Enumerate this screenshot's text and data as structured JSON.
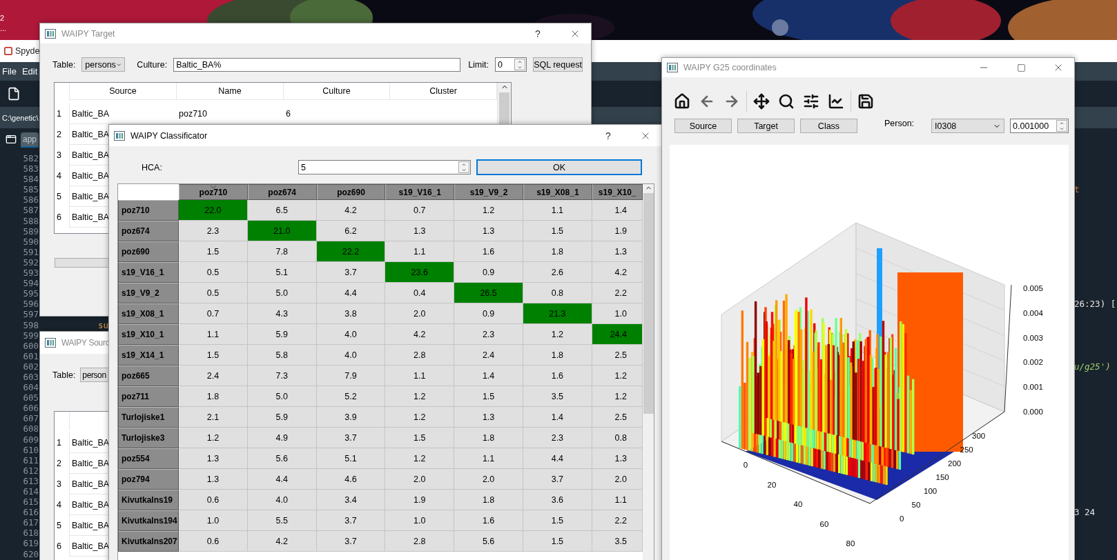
{
  "desktop": {
    "labels": [
      "2",
      "..."
    ]
  },
  "spyder": {
    "title": "Spyde",
    "menu": [
      "File",
      "Edit"
    ],
    "path": "C:\\genetic\\",
    "tab": "app",
    "lines": [
      {
        "number": "582"
      },
      {
        "number": "583"
      },
      {
        "number": "584"
      },
      {
        "number": "585",
        "console": {
          "text": "t",
          "kind": "keyword"
        }
      },
      {
        "number": "586"
      },
      {
        "number": "587"
      },
      {
        "number": "588"
      },
      {
        "number": "589"
      },
      {
        "number": "590"
      },
      {
        "number": "591"
      },
      {
        "number": "592"
      },
      {
        "number": "593"
      },
      {
        "number": "594"
      },
      {
        "number": "595"
      },
      {
        "number": "596",
        "console": {
          "text": "26:23) [",
          "kind": "plain"
        }
      },
      {
        "number": "597"
      },
      {
        "number": "598",
        "code": "su"
      },
      {
        "number": "599"
      },
      {
        "number": "600"
      },
      {
        "number": "601"
      },
      {
        "number": "602",
        "console": {
          "text": "u/g25')",
          "kind": "string"
        }
      },
      {
        "number": "603"
      },
      {
        "number": "604"
      },
      {
        "number": "605"
      },
      {
        "number": "606"
      },
      {
        "number": "607"
      },
      {
        "number": "608"
      },
      {
        "number": "609"
      },
      {
        "number": "610"
      },
      {
        "number": "611"
      },
      {
        "number": "612"
      },
      {
        "number": "613"
      },
      {
        "number": "614"
      },
      {
        "number": "615"
      },
      {
        "number": "616",
        "console": {
          "text": "3 24",
          "kind": "plain"
        }
      },
      {
        "number": "617"
      },
      {
        "number": "618"
      },
      {
        "number": "619"
      },
      {
        "number": "620"
      }
    ]
  },
  "target_window": {
    "title": "WAIPY Target",
    "help": "?",
    "table_label": "Table:",
    "table_value": "persons",
    "culture_label": "Culture:",
    "culture_value": "Baltic_BA%",
    "limit_label": "Limit:",
    "limit_value": "0",
    "sql_button": "SQL request",
    "columns": [
      "Source",
      "Name",
      "Culture",
      "Cluster"
    ],
    "rows": [
      {
        "number": "1",
        "cells": [
          "Baltic_BA",
          "poz710",
          "6"
        ]
      },
      {
        "number": "2",
        "cells": [
          "Baltic_BA"
        ]
      },
      {
        "number": "3",
        "cells": [
          "Baltic_BA"
        ]
      },
      {
        "number": "4",
        "cells": [
          "Baltic_BA"
        ]
      },
      {
        "number": "5",
        "cells": [
          "Baltic_BA"
        ]
      },
      {
        "number": "6",
        "cells": [
          "Baltic_BA"
        ]
      }
    ]
  },
  "source_window": {
    "title": "WAIPY Sourc",
    "table_label": "Table:",
    "table_value": "person",
    "rows": [
      {
        "number": "1",
        "cells": [
          "Baltic_BA"
        ]
      },
      {
        "number": "2",
        "cells": [
          "Baltic_BA"
        ]
      },
      {
        "number": "3",
        "cells": [
          "Baltic_BA"
        ]
      },
      {
        "number": "4",
        "cells": [
          "Baltic_BA"
        ]
      },
      {
        "number": "5",
        "cells": [
          "Baltic_BA"
        ]
      },
      {
        "number": "6",
        "cells": [
          "Baltic_BA"
        ]
      }
    ]
  },
  "classificator_window": {
    "title": "WAIPY Classificator",
    "help": "?",
    "hca_label": "HCA:",
    "hca_value": "5",
    "ok_button": "OK",
    "columns": [
      {
        "label": "poz710",
        "sorted": true
      },
      {
        "label": "poz674",
        "sorted": false
      },
      {
        "label": "poz690",
        "sorted": false
      },
      {
        "label": "s19_V16_1",
        "sorted": false
      },
      {
        "label": "s19_V9_2",
        "sorted": false
      },
      {
        "label": "s19_X08_1",
        "sorted": false
      },
      {
        "label": "s19_X10_",
        "sorted": false
      }
    ],
    "rows": [
      {
        "name": "poz710",
        "cells": [
          {
            "text": "22.0",
            "highlighted": true
          },
          {
            "text": "6.5",
            "highlighted": false
          },
          {
            "text": "4.2",
            "highlighted": false
          },
          {
            "text": "0.7",
            "highlighted": false
          },
          {
            "text": "1.2",
            "highlighted": false
          },
          {
            "text": "1.1",
            "highlighted": false
          },
          {
            "text": "1.4",
            "highlighted": false
          }
        ]
      },
      {
        "name": "poz674",
        "cells": [
          {
            "text": "2.3",
            "highlighted": false
          },
          {
            "text": "21.0",
            "highlighted": true
          },
          {
            "text": "6.2",
            "highlighted": false
          },
          {
            "text": "1.3",
            "highlighted": false
          },
          {
            "text": "1.3",
            "highlighted": false
          },
          {
            "text": "1.5",
            "highlighted": false
          },
          {
            "text": "1.9",
            "highlighted": false
          }
        ]
      },
      {
        "name": "poz690",
        "cells": [
          {
            "text": "1.5",
            "highlighted": false
          },
          {
            "text": "7.8",
            "highlighted": false
          },
          {
            "text": "22.2",
            "highlighted": true
          },
          {
            "text": "1.1",
            "highlighted": false
          },
          {
            "text": "1.6",
            "highlighted": false
          },
          {
            "text": "1.8",
            "highlighted": false
          },
          {
            "text": "1.3",
            "highlighted": false
          }
        ]
      },
      {
        "name": "s19_V16_1",
        "cells": [
          {
            "text": "0.5",
            "highlighted": false
          },
          {
            "text": "5.1",
            "highlighted": false
          },
          {
            "text": "3.7",
            "highlighted": false
          },
          {
            "text": "23.6",
            "highlighted": true
          },
          {
            "text": "0.9",
            "highlighted": false
          },
          {
            "text": "2.6",
            "highlighted": false
          },
          {
            "text": "4.2",
            "highlighted": false
          }
        ]
      },
      {
        "name": "s19_V9_2",
        "cells": [
          {
            "text": "0.5",
            "highlighted": false
          },
          {
            "text": "5.0",
            "highlighted": false
          },
          {
            "text": "4.4",
            "highlighted": false
          },
          {
            "text": "0.4",
            "highlighted": false
          },
          {
            "text": "26.5",
            "highlighted": true
          },
          {
            "text": "0.8",
            "highlighted": false
          },
          {
            "text": "2.2",
            "highlighted": false
          }
        ]
      },
      {
        "name": "s19_X08_1",
        "cells": [
          {
            "text": "0.7",
            "highlighted": false
          },
          {
            "text": "4.3",
            "highlighted": false
          },
          {
            "text": "3.8",
            "highlighted": false
          },
          {
            "text": "2.0",
            "highlighted": false
          },
          {
            "text": "0.9",
            "highlighted": false
          },
          {
            "text": "21.3",
            "highlighted": true
          },
          {
            "text": "1.0",
            "highlighted": false
          }
        ]
      },
      {
        "name": "s19_X10_1",
        "cells": [
          {
            "text": "1.1",
            "highlighted": false
          },
          {
            "text": "5.9",
            "highlighted": false
          },
          {
            "text": "4.0",
            "highlighted": false
          },
          {
            "text": "4.2",
            "highlighted": false
          },
          {
            "text": "2.3",
            "highlighted": false
          },
          {
            "text": "1.2",
            "highlighted": false
          },
          {
            "text": "24.4",
            "highlighted": true
          }
        ]
      },
      {
        "name": "s19_X14_1",
        "cells": [
          {
            "text": "1.5",
            "highlighted": false
          },
          {
            "text": "5.8",
            "highlighted": false
          },
          {
            "text": "4.0",
            "highlighted": false
          },
          {
            "text": "2.8",
            "highlighted": false
          },
          {
            "text": "2.4",
            "highlighted": false
          },
          {
            "text": "1.8",
            "highlighted": false
          },
          {
            "text": "2.5",
            "highlighted": false
          }
        ]
      },
      {
        "name": "poz665",
        "cells": [
          {
            "text": "2.4",
            "highlighted": false
          },
          {
            "text": "7.3",
            "highlighted": false
          },
          {
            "text": "7.9",
            "highlighted": false
          },
          {
            "text": "1.1",
            "highlighted": false
          },
          {
            "text": "1.4",
            "highlighted": false
          },
          {
            "text": "1.6",
            "highlighted": false
          },
          {
            "text": "1.2",
            "highlighted": false
          }
        ]
      },
      {
        "name": "poz711",
        "cells": [
          {
            "text": "1.8",
            "highlighted": false
          },
          {
            "text": "5.0",
            "highlighted": false
          },
          {
            "text": "5.2",
            "highlighted": false
          },
          {
            "text": "1.2",
            "highlighted": false
          },
          {
            "text": "1.5",
            "highlighted": false
          },
          {
            "text": "3.5",
            "highlighted": false
          },
          {
            "text": "1.2",
            "highlighted": false
          }
        ]
      },
      {
        "name": "Turlojiske1",
        "cells": [
          {
            "text": "2.1",
            "highlighted": false
          },
          {
            "text": "5.9",
            "highlighted": false
          },
          {
            "text": "3.9",
            "highlighted": false
          },
          {
            "text": "1.2",
            "highlighted": false
          },
          {
            "text": "1.3",
            "highlighted": false
          },
          {
            "text": "1.4",
            "highlighted": false
          },
          {
            "text": "2.5",
            "highlighted": false
          }
        ]
      },
      {
        "name": "Turlojiske3",
        "cells": [
          {
            "text": "1.2",
            "highlighted": false
          },
          {
            "text": "4.9",
            "highlighted": false
          },
          {
            "text": "3.7",
            "highlighted": false
          },
          {
            "text": "1.5",
            "highlighted": false
          },
          {
            "text": "1.8",
            "highlighted": false
          },
          {
            "text": "2.3",
            "highlighted": false
          },
          {
            "text": "0.8",
            "highlighted": false
          }
        ]
      },
      {
        "name": "poz554",
        "cells": [
          {
            "text": "1.3",
            "highlighted": false
          },
          {
            "text": "5.6",
            "highlighted": false
          },
          {
            "text": "5.1",
            "highlighted": false
          },
          {
            "text": "1.2",
            "highlighted": false
          },
          {
            "text": "1.1",
            "highlighted": false
          },
          {
            "text": "4.4",
            "highlighted": false
          },
          {
            "text": "1.3",
            "highlighted": false
          }
        ]
      },
      {
        "name": "poz794",
        "cells": [
          {
            "text": "1.3",
            "highlighted": false
          },
          {
            "text": "4.4",
            "highlighted": false
          },
          {
            "text": "4.6",
            "highlighted": false
          },
          {
            "text": "2.0",
            "highlighted": false
          },
          {
            "text": "2.0",
            "highlighted": false
          },
          {
            "text": "3.7",
            "highlighted": false
          },
          {
            "text": "2.0",
            "highlighted": false
          }
        ]
      },
      {
        "name": "Kivutkalns19",
        "cells": [
          {
            "text": "0.6",
            "highlighted": false
          },
          {
            "text": "4.0",
            "highlighted": false
          },
          {
            "text": "3.4",
            "highlighted": false
          },
          {
            "text": "1.9",
            "highlighted": false
          },
          {
            "text": "1.8",
            "highlighted": false
          },
          {
            "text": "3.6",
            "highlighted": false
          },
          {
            "text": "1.1",
            "highlighted": false
          }
        ]
      },
      {
        "name": "Kivutkalns194",
        "cells": [
          {
            "text": "1.0",
            "highlighted": false
          },
          {
            "text": "5.5",
            "highlighted": false
          },
          {
            "text": "3.7",
            "highlighted": false
          },
          {
            "text": "1.0",
            "highlighted": false
          },
          {
            "text": "1.6",
            "highlighted": false
          },
          {
            "text": "1.5",
            "highlighted": false
          },
          {
            "text": "2.2",
            "highlighted": false
          }
        ]
      },
      {
        "name": "Kivutkalns207",
        "cells": [
          {
            "text": "0.6",
            "highlighted": false
          },
          {
            "text": "4.2",
            "highlighted": false
          },
          {
            "text": "3.7",
            "highlighted": false
          },
          {
            "text": "2.8",
            "highlighted": false
          },
          {
            "text": "5.6",
            "highlighted": false
          },
          {
            "text": "1.5",
            "highlighted": false
          },
          {
            "text": "3.5",
            "highlighted": false
          }
        ]
      }
    ]
  },
  "g25_window": {
    "title": "WAIPY G25 coordinates",
    "buttons": [
      "Source",
      "Target",
      "Class"
    ],
    "person_label": "Person:",
    "person_value": "I0308",
    "threshold_value": "0.001000",
    "plot": {
      "z_ticks": [
        "0.005",
        "0.004",
        "0.003",
        "0.002",
        "0.001",
        "0.000"
      ],
      "x_ticks": [
        "0",
        "20",
        "40",
        "60",
        "80"
      ],
      "y_ticks": [
        "300",
        "250",
        "200",
        "150",
        "100",
        "50",
        "0"
      ]
    }
  }
}
